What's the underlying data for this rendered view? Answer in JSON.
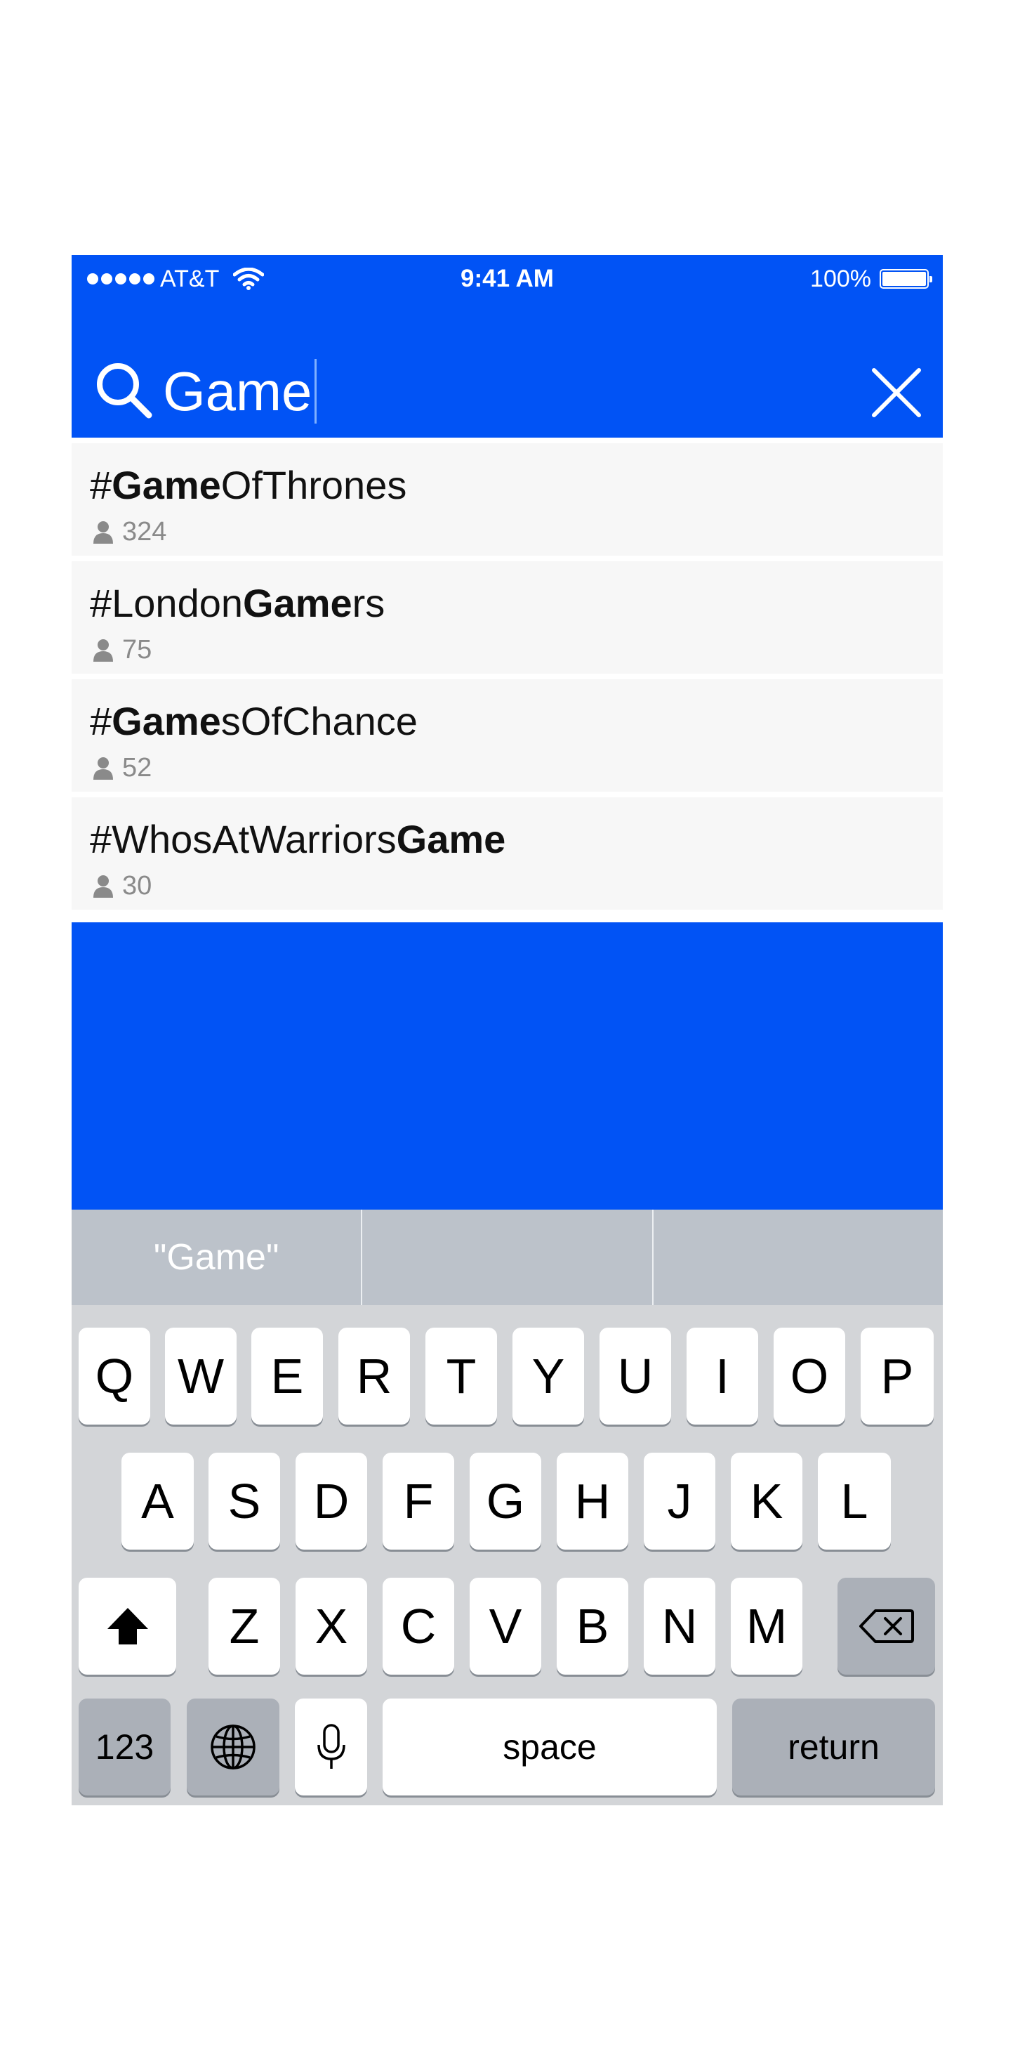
{
  "status_bar": {
    "carrier": "AT&T",
    "time": "9:41 AM",
    "battery": "100%"
  },
  "search": {
    "query": "Game"
  },
  "results": [
    {
      "prefix": "#",
      "match": "Game",
      "after": "OfThrones",
      "count": "324"
    },
    {
      "prefix": "#London",
      "match": "Game",
      "after": "rs",
      "count": "75"
    },
    {
      "prefix": "#",
      "match": "Game",
      "after": "sOfChance",
      "count": "52"
    },
    {
      "prefix": "#WhosAtWarriors",
      "match": "Game",
      "after": "",
      "count": "30"
    }
  ],
  "keyboard": {
    "suggestions": [
      "\"Game\"",
      "",
      ""
    ],
    "row1": [
      "Q",
      "W",
      "E",
      "R",
      "T",
      "Y",
      "U",
      "I",
      "O",
      "P"
    ],
    "row2": [
      "A",
      "S",
      "D",
      "F",
      "G",
      "H",
      "J",
      "K",
      "L"
    ],
    "row3": [
      "Z",
      "X",
      "C",
      "V",
      "B",
      "N",
      "M"
    ],
    "numbers_label": "123",
    "space_label": "space",
    "return_label": "return",
    "icons": {
      "shift": "shift-icon",
      "delete": "backspace-icon",
      "globe": "globe-icon",
      "mic": "microphone-icon"
    }
  },
  "colors": {
    "accent": "#0153F5",
    "row_bg": "#F7F7F7",
    "keyboard_bg": "#D3D5D8"
  }
}
